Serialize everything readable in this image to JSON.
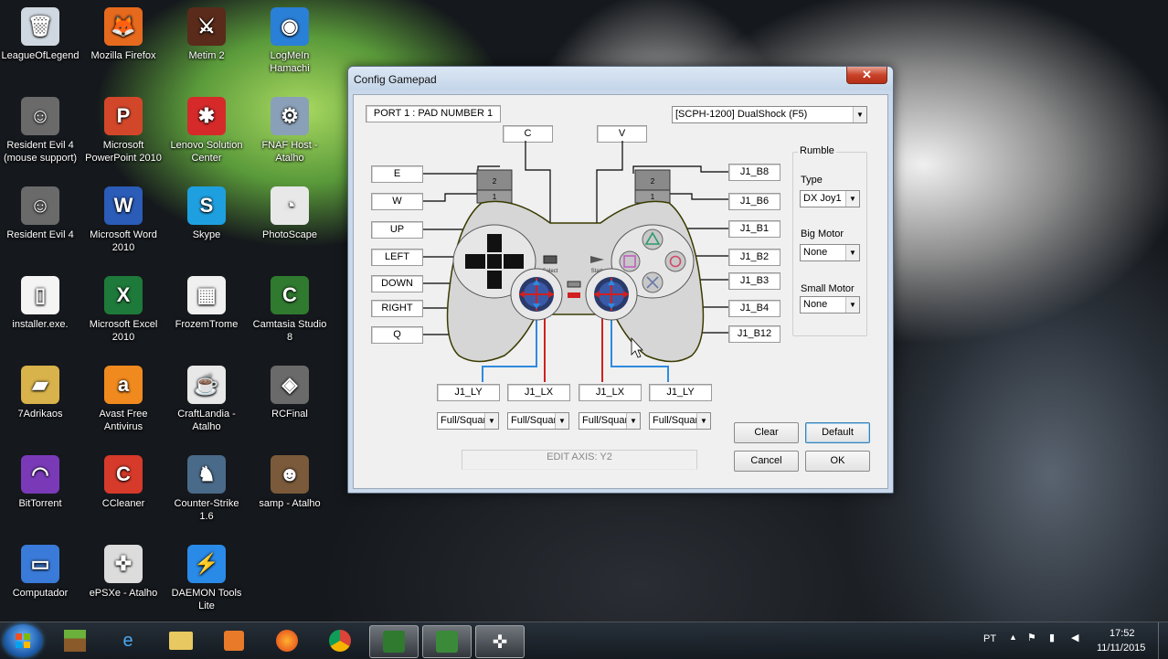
{
  "desktop": {
    "icons": [
      {
        "label": "LeagueOfLegend",
        "color": "#cfd8e0",
        "glyph": "🗑"
      },
      {
        "label": "Mozilla Firefox",
        "color": "#e66a1e",
        "glyph": "🦊"
      },
      {
        "label": "Metim 2",
        "color": "#5a2a1a",
        "glyph": "⚔"
      },
      {
        "label": "LogMeIn Hamachi",
        "color": "#2a7fd6",
        "glyph": "◉"
      },
      {
        "label": "Resident Evil 4 (mouse support)",
        "color": "#6a6a6a",
        "glyph": "☺"
      },
      {
        "label": "Microsoft PowerPoint 2010",
        "color": "#d2472a",
        "glyph": "P"
      },
      {
        "label": "Lenovo Solution Center",
        "color": "#d62a2a",
        "glyph": "✱"
      },
      {
        "label": "FNAF Host - Atalho",
        "color": "#8aa0b8",
        "glyph": "⚙"
      },
      {
        "label": "Resident Evil 4",
        "color": "#6a6a6a",
        "glyph": "☺"
      },
      {
        "label": "Microsoft Word 2010",
        "color": "#2a5cb8",
        "glyph": "W"
      },
      {
        "label": "Skype",
        "color": "#1ea0e0",
        "glyph": "S"
      },
      {
        "label": "PhotoScape",
        "color": "#e8e8e8",
        "glyph": "◔"
      },
      {
        "label": "installer.exe.",
        "color": "#f4f4f4",
        "glyph": "▯"
      },
      {
        "label": "Microsoft Excel 2010",
        "color": "#1e7a3a",
        "glyph": "X"
      },
      {
        "label": "FrozemTrome",
        "color": "#f0f0f0",
        "glyph": "▦"
      },
      {
        "label": "Camtasia Studio 8",
        "color": "#2f7a2f",
        "glyph": "C"
      },
      {
        "label": "7Adrikaos",
        "color": "#d8b24a",
        "glyph": "▰"
      },
      {
        "label": "Avast Free Antivirus",
        "color": "#f08a1e",
        "glyph": "a"
      },
      {
        "label": "CraftLandia - Atalho",
        "color": "#e8e8e8",
        "glyph": "☕"
      },
      {
        "label": "RCFinal",
        "color": "#6a6a6a",
        "glyph": "◈"
      },
      {
        "label": "BitTorrent",
        "color": "#7a3ab8",
        "glyph": "◠"
      },
      {
        "label": "CCleaner",
        "color": "#d63a2a",
        "glyph": "C"
      },
      {
        "label": "Counter-Strike 1.6",
        "color": "#4a6a8a",
        "glyph": "♞"
      },
      {
        "label": "samp - Atalho",
        "color": "#7a5a3a",
        "glyph": "☻"
      },
      {
        "label": "Computador",
        "color": "#3a7ad8",
        "glyph": "▭"
      },
      {
        "label": "ePSXe - Atalho",
        "color": "#dcdcdc",
        "glyph": "✜"
      },
      {
        "label": "DAEMON Tools Lite",
        "color": "#2a8ae8",
        "glyph": "⚡"
      }
    ]
  },
  "window": {
    "title": "Config Gamepad",
    "close_label": "✕",
    "port_label": "PORT 1 : PAD NUMBER 1",
    "pad_type": "[SCPH-1200] DualShock (F5)",
    "top_buttons": {
      "c": "C",
      "v": "V"
    },
    "left_buttons": [
      "E",
      "W",
      "UP",
      "LEFT",
      "DOWN",
      "RIGHT",
      "Q"
    ],
    "right_buttons": [
      "J1_B8",
      "J1_B6",
      "J1_B1",
      "J1_B2",
      "J1_B3",
      "J1_B4",
      "J1_B12"
    ],
    "axis_labels": [
      "J1_LY",
      "J1_LX",
      "J1_LX",
      "J1_LY"
    ],
    "axis_modes": [
      "Full/Squar",
      "Full/Squar",
      "Full/Squar",
      "Full/Squar"
    ],
    "controller_small": {
      "select": "Select",
      "start": "Start",
      "l2": "2",
      "l1": "1",
      "r2": "2",
      "r1": "1"
    },
    "rumble": {
      "title": "Rumble",
      "type_label": "Type",
      "type_value": "DX Joy1",
      "big_motor_label": "Big Motor",
      "big_motor_value": "None",
      "small_motor_label": "Small Motor",
      "small_motor_value": "None"
    },
    "edit_axis": "EDIT AXIS: Y2",
    "buttons": {
      "clear": "Clear",
      "default": "Default",
      "cancel": "Cancel",
      "ok": "OK"
    }
  },
  "taskbar": {
    "language": "PT",
    "time": "17:52",
    "date": "11/11/2015"
  }
}
